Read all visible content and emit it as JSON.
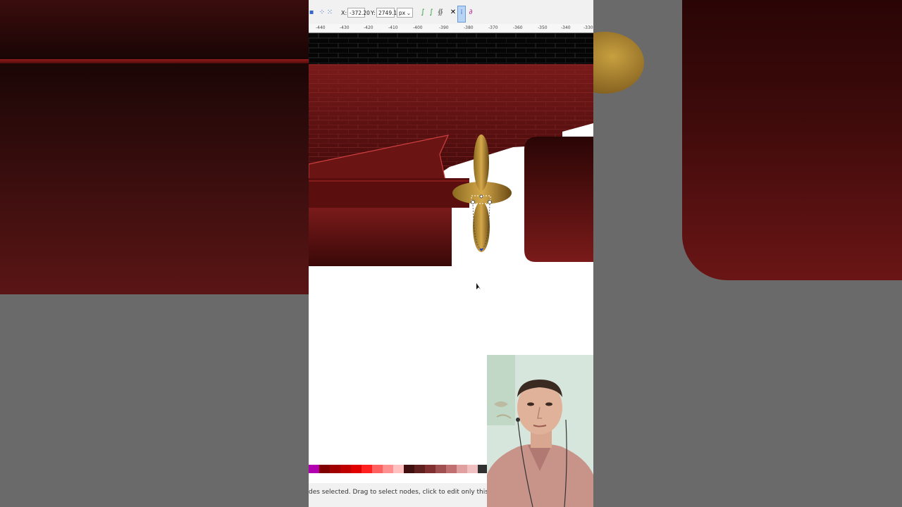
{
  "toolbar": {
    "x_label": "X:",
    "x_value": "-372.20",
    "y_label": "Y:",
    "y_value": "2749.10",
    "unit": "px"
  },
  "ruler": {
    "ticks": [
      "-440",
      "-430",
      "-420",
      "-410",
      "-400",
      "-390",
      "-380",
      "-370",
      "-360",
      "-350",
      "-340",
      "-330"
    ]
  },
  "palette": {
    "colors": [
      "#b000b0",
      "#800000",
      "#a00000",
      "#c00000",
      "#e00000",
      "#ff2020",
      "#ff6060",
      "#ff9090",
      "#ffc0c0",
      "#401010",
      "#602020",
      "#803030",
      "#a05050",
      "#c07070",
      "#e0a0a0",
      "#f0c0c0",
      "#303030",
      "#505050",
      "#707070",
      "#908080",
      "#b0a0a0",
      "#d0c0c0",
      "#ff8000",
      "#ff9a20",
      "#ffb040",
      "#c06000",
      "#a05000"
    ]
  },
  "status": {
    "message": "des selected. Drag to select nodes, click to edit only this object (more: Shift)"
  }
}
